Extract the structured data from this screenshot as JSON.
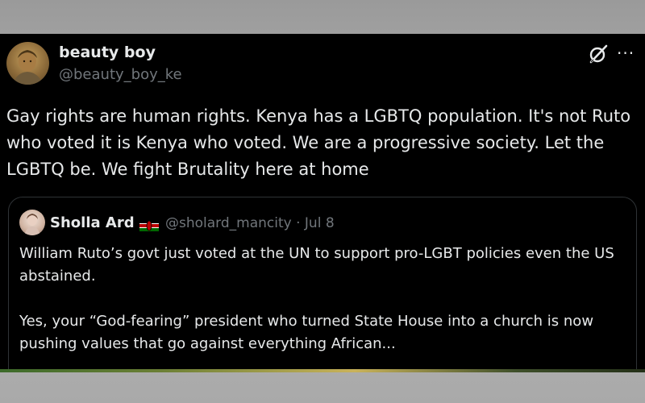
{
  "post": {
    "author": {
      "display_name": "beauty boy",
      "handle": "@beauty_boy_ke"
    },
    "icons": {
      "grok": "grok-icon",
      "more": "more-options-icon"
    },
    "more_label": "···",
    "text": "Gay rights are human rights. Kenya has a LGBTQ population. It's not Ruto who voted it is Kenya who voted. We are a progressive society. Let the LGBTQ be. We fight Brutality here at home"
  },
  "quote": {
    "author": {
      "display_name": "Sholla Ard",
      "flag": "kenya-flag",
      "handle": "@sholard_mancity",
      "separator": "·",
      "date": "Jul 8"
    },
    "paragraphs": [
      "William Ruto’s govt just voted at the UN to support pro-LGBT policies even the US abstained.",
      "Yes, your “God-fearing” president who turned State House into a church is now pushing values that go against everything African..."
    ]
  },
  "colors": {
    "background": "#000000",
    "text_primary": "#e7e9ea",
    "text_secondary": "#71767b",
    "border": "#2f3336"
  }
}
